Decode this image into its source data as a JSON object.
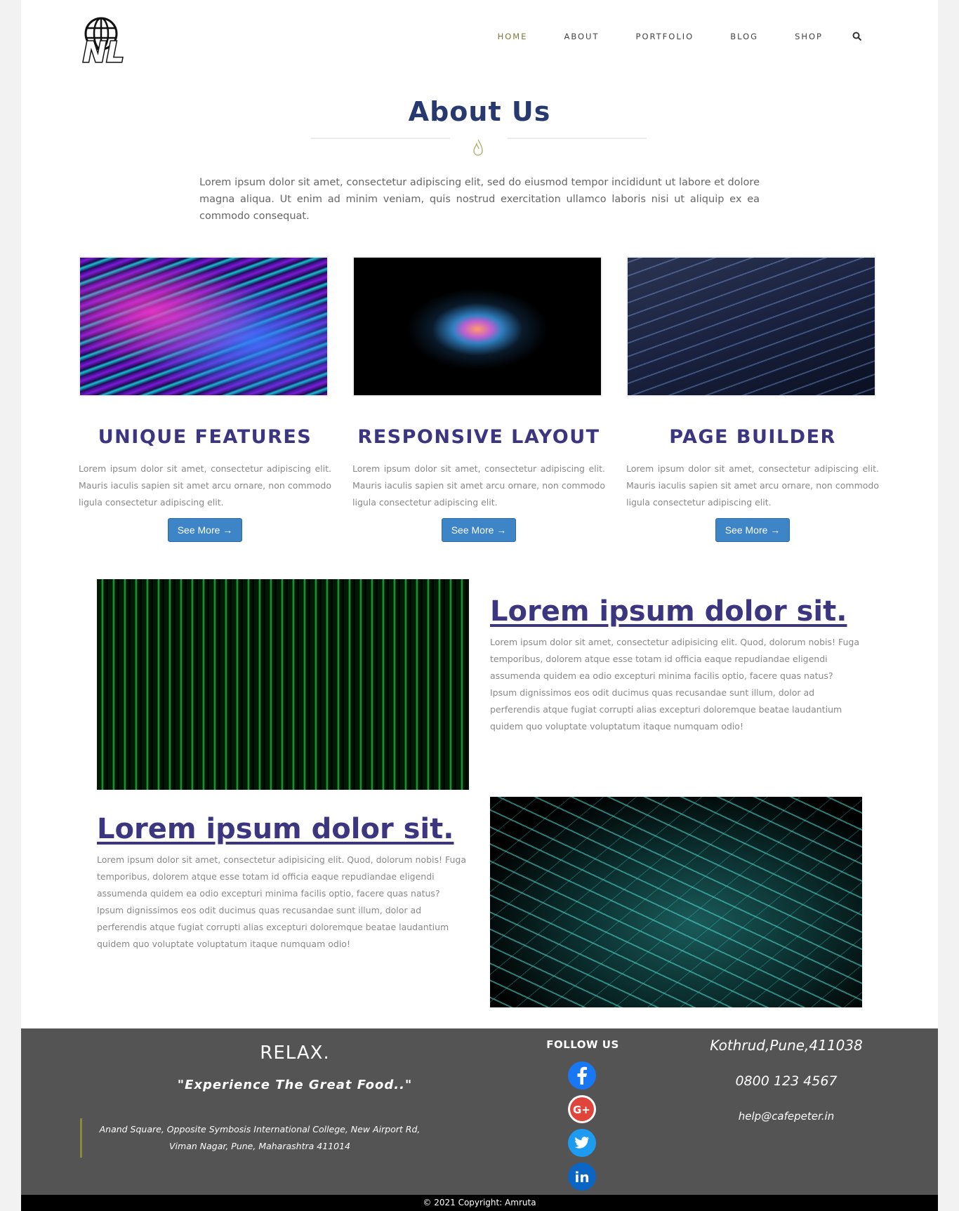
{
  "nav": {
    "items": [
      "HOME",
      "ABOUT",
      "PORTFOLIO",
      "BLOG",
      "SHOP"
    ],
    "active": "HOME",
    "search_icon": "search-icon"
  },
  "logo": {
    "text": "NL"
  },
  "about": {
    "title": "About Us",
    "text": "Lorem ipsum dolor sit amet, consectetur adipiscing elit, sed do eiusmod tempor incididunt ut labore et dolore magna aliqua. Ut enim ad minim veniam, quis nostrud exercitation ullamco laboris nisi ut aliquip ex ea commodo consequat."
  },
  "features": [
    {
      "title": "UNIQUE FEATURES",
      "text": "Lorem ipsum dolor sit amet, consectetur adipiscing elit. Mauris iaculis sapien sit amet arcu ornare, non commodo ligula consectetur adipiscing elit.",
      "button": "See More →"
    },
    {
      "title": "RESPONSIVE LAYOUT",
      "text": "Lorem ipsum dolor sit amet, consectetur adipiscing elit. Mauris iaculis sapien sit amet arcu ornare, non commodo ligula consectetur adipiscing elit.",
      "button": "See More →"
    },
    {
      "title": "PAGE BUILDER",
      "text": "Lorem ipsum dolor sit amet, consectetur adipiscing elit. Mauris iaculis sapien sit amet arcu ornare, non commodo ligula consectetur adipiscing elit.",
      "button": "See More →"
    }
  ],
  "rows": [
    {
      "title": "Lorem ipsum dolor sit.",
      "text": "Lorem ipsum dolor sit amet, consectetur adipisicing elit. Quod, dolorum nobis! Fuga temporibus, dolorem atque esse totam id officia eaque repudiandae eligendi assumenda quidem ea odio excepturi minima facilis optio, facere quas natus? Ipsum dignissimos eos odit ducimus quas recusandae sunt illum, dolor ad perferendis atque fugiat corrupti alias excepturi doloremque beatae laudantium quidem quo voluptate voluptatum itaque numquam odio!"
    },
    {
      "title": "Lorem ipsum dolor sit.",
      "text": "Lorem ipsum dolor sit amet, consectetur adipisicing elit. Quod, dolorum nobis! Fuga temporibus, dolorem atque esse totam id officia eaque repudiandae eligendi assumenda quidem ea odio excepturi minima facilis optio, facere quas natus? Ipsum dignissimos eos odit ducimus quas recusandae sunt illum, dolor ad perferendis atque fugiat corrupti alias excepturi doloremque beatae laudantium quidem quo voluptate voluptatum itaque numquam odio!"
    }
  ],
  "footer": {
    "relax": "RELAX.",
    "tagline": "\"Experience The Great Food..\"",
    "address_line1": "Anand Square, Opposite Symbosis International College, New Airport Rd,",
    "address_line2": "Viman Nagar, Pune, Maharashtra 411014",
    "follow": "FOLLOW US",
    "social": [
      "facebook-icon",
      "google-plus-icon",
      "twitter-icon",
      "linkedin-icon"
    ],
    "location": "Kothrud,Pune,411038",
    "phone": "0800 123 4567",
    "email": "help@cafepeter.in",
    "copyright": "© 2021 Copyright: Amruta"
  },
  "colors": {
    "title": "#27396e",
    "heading": "#3c3580",
    "button": "#3d85c6",
    "footer": "#555455",
    "active_nav": "#7c7a3c"
  }
}
